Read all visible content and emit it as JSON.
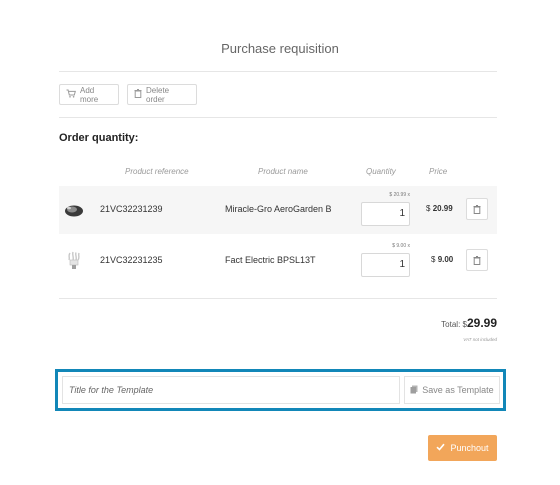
{
  "header": {
    "title": "Purchase requisition"
  },
  "toolbar": {
    "add_more_label": "Add more",
    "delete_order_label": "Delete order"
  },
  "order": {
    "section_title": "Order quantity:",
    "columns": {
      "product_reference": "Product reference",
      "product_name": "Product name",
      "quantity": "Quantity",
      "price": "Price"
    },
    "items": [
      {
        "reference": "21VC32231239",
        "name": "Miracle-Gro AeroGarden B",
        "unit_price": "$ 20.99 x",
        "quantity": "1",
        "price_symbol": "$",
        "price": "20.99",
        "icon": "garden-pod-icon"
      },
      {
        "reference": "21VC32231235",
        "name": "Fact Electric BPSL13T",
        "unit_price": "$ 9.00 x",
        "quantity": "1",
        "price_symbol": "$",
        "price": "9.00",
        "icon": "lightbulb-icon"
      }
    ],
    "total_label": "Total: $",
    "total_value": "29.99",
    "vat_note": "VAT not included"
  },
  "template": {
    "title_placeholder": "Title for the Template",
    "save_label": "Save as Template",
    "highlight_color": "#1287b8"
  },
  "actions": {
    "punchout_label": "Punchout",
    "punchout_color": "#f2a65a"
  }
}
